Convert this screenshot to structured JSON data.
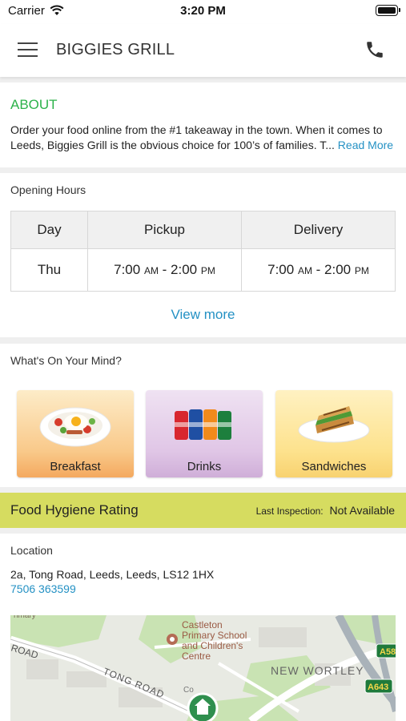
{
  "status_bar": {
    "carrier": "Carrier",
    "time": "3:20 PM"
  },
  "header": {
    "title": "BIGGIES GRILL",
    "menu_icon": "hamburger-menu-icon",
    "call_icon": "phone-icon"
  },
  "about": {
    "heading": "ABOUT",
    "text": "Order your food online from the #1 takeaway in the town. When it comes to Leeds, Biggies Grill is the obvious choice for 100’s of families. T...",
    "read_more": "Read More",
    "heading_color": "#2cb24a",
    "link_color": "#2491c4"
  },
  "opening_hours": {
    "heading": "Opening Hours",
    "columns": [
      "Day",
      "Pickup",
      "Delivery"
    ],
    "rows": [
      {
        "day": "Thu",
        "pickup": {
          "open": "7:00",
          "open_suffix": "AM",
          "separator": " - ",
          "close": "2:00",
          "close_suffix": "PM"
        },
        "delivery": {
          "open": "7:00",
          "open_suffix": "AM",
          "separator": " - ",
          "close": "2:00",
          "close_suffix": "PM"
        }
      }
    ],
    "view_more": "View more"
  },
  "whats_on_your_mind": {
    "heading": "What's On Your Mind?",
    "categories": [
      {
        "label": "Breakfast",
        "icon": "breakfast-plate-icon"
      },
      {
        "label": "Drinks",
        "icon": "drink-cans-icon"
      },
      {
        "label": "Sandwiches",
        "icon": "sandwich-plate-icon"
      }
    ]
  },
  "hygiene": {
    "title": "Food Hygiene Rating",
    "last_inspection_label": "Last Inspection:",
    "last_inspection_value": "Not Available",
    "bar_color": "#d6dc60"
  },
  "location": {
    "heading": "Location",
    "address": "2a, Tong Road, Leeds, Leeds, LS12 1HX",
    "phone": "7506 363599",
    "map": {
      "labels": {
        "school_line1": "Castleton",
        "school_line2": "Primary School",
        "school_line3": "and Children's",
        "school_line4": "Centre",
        "road_left": "ROAD",
        "tong_road": "TONG ROAD",
        "area": "NEW WORTLEY",
        "a58": "A58",
        "a643": "A643",
        "fragment_top": "rimary",
        "fragment_co": "Co"
      }
    }
  }
}
